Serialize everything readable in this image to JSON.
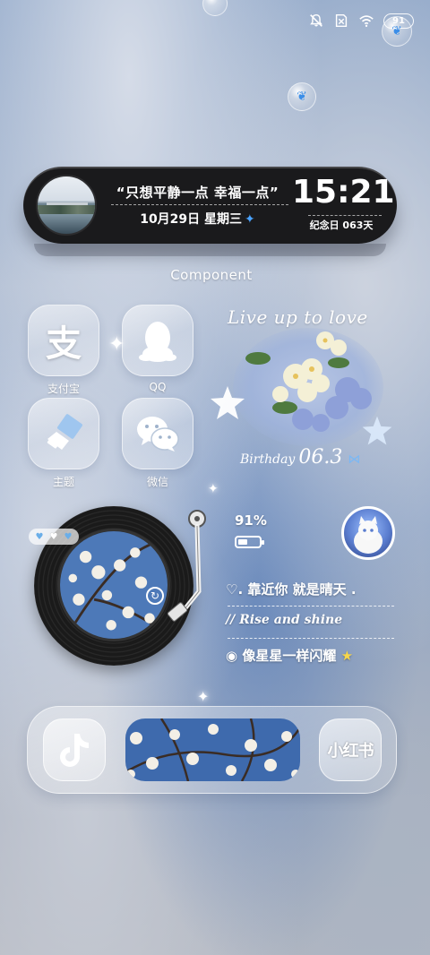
{
  "status_bar": {
    "battery": "91"
  },
  "top_widget": {
    "quote": "“只想平静一点 幸福一点”",
    "date": "10月29日  星期三",
    "time": "15:21",
    "memorial": "纪念日  063天"
  },
  "component_label": "Component",
  "apps": [
    {
      "label": "支付宝",
      "glyph": "支",
      "icon": "alipay-icon"
    },
    {
      "label": "QQ",
      "icon": "qq-penguin-icon"
    },
    {
      "label": "主题",
      "icon": "theme-brush-icon"
    },
    {
      "label": "微信",
      "icon": "wechat-icon"
    }
  ],
  "flower_widget": {
    "title": "Live up to love",
    "birthday_label": "Birthday",
    "birthday_number": "06.3"
  },
  "status_widget": {
    "battery_percent": "91%",
    "line1": "♡. 靠近你 就是晴天 .",
    "line2": "//  Rise and shine",
    "line3": "像星星一样闪耀"
  },
  "dock": {
    "douyin_icon": "douyin-icon",
    "xiaohongshu_label": "小红书"
  },
  "colors": {
    "widget_bg": "#1a1a1c",
    "accent_blue": "#4aa3ff"
  }
}
